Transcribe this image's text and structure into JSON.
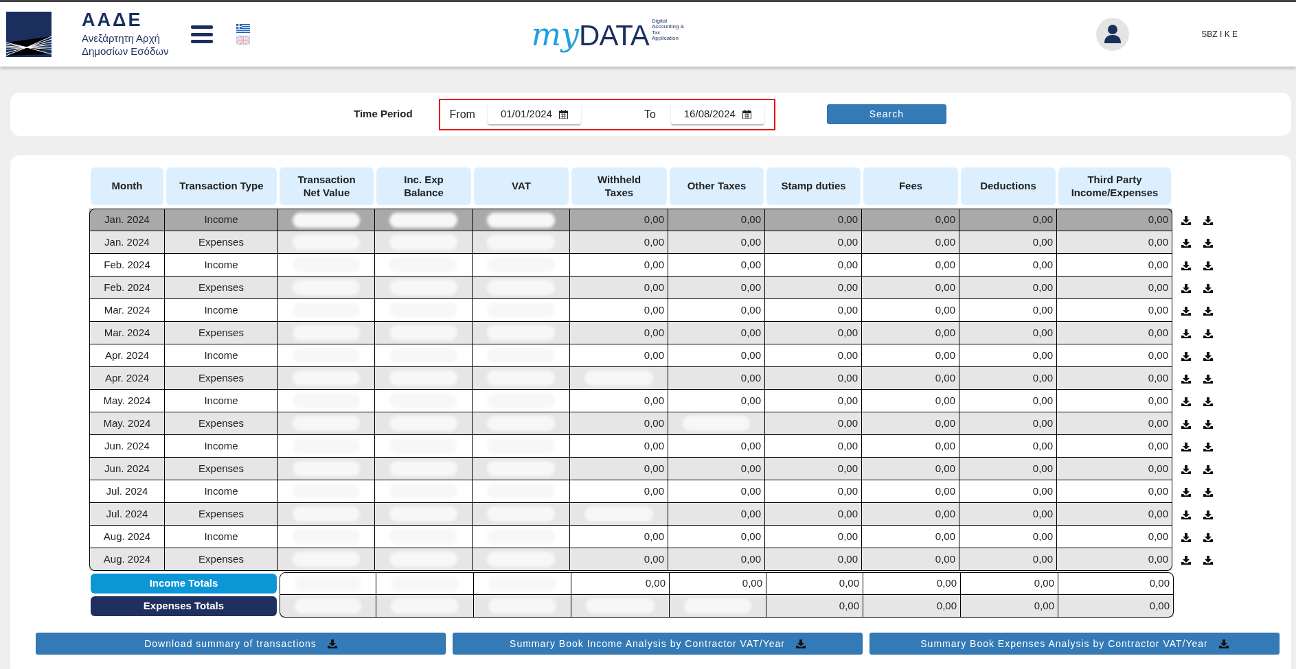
{
  "header": {
    "logo": {
      "title": "ΑΑΔΕ",
      "subtitle_lines": [
        "Ανεξάρτητη Αρχή",
        "Δημοσίων Εσόδων"
      ]
    },
    "languages": [
      {
        "kind": "greek",
        "selected": true
      },
      {
        "kind": "english",
        "selected": false
      }
    ],
    "app_logo": {
      "script": "my",
      "word": "DATA",
      "tagline_lines": [
        "Digital",
        "Accounting &",
        "Tax",
        "Application"
      ]
    },
    "user": "SBZ I K E"
  },
  "filter": {
    "label": "Time Period",
    "from_label": "From",
    "from": "01/01/2024",
    "to_label": "To",
    "to": "16/08/2024",
    "button": "Search"
  },
  "table": {
    "columns": [
      "Month",
      "Transaction Type",
      "Transaction Net Value",
      "Inc. Exp Balance",
      "VAT",
      "Withheld Taxes",
      "Other Taxes",
      "Stamp duties",
      "Fees",
      "Deductions",
      "Third Party Income/Expenses"
    ],
    "rows": [
      {
        "month": "Jan. 2024",
        "type": "Income",
        "selected": true,
        "cells": [
          {
            "kind": "redacted"
          },
          {
            "kind": "redacted"
          },
          {
            "kind": "redacted"
          },
          {
            "kind": "value",
            "text": "0,00"
          },
          {
            "kind": "value",
            "text": "0,00"
          },
          {
            "kind": "value",
            "text": "0,00"
          },
          {
            "kind": "value",
            "text": "0,00"
          },
          {
            "kind": "value",
            "text": "0,00"
          },
          {
            "kind": "value",
            "text": "0,00"
          }
        ]
      },
      {
        "month": "Jan. 2024",
        "type": "Expenses",
        "selected": false,
        "cells": [
          {
            "kind": "redacted"
          },
          {
            "kind": "redacted"
          },
          {
            "kind": "redacted"
          },
          {
            "kind": "value",
            "text": "0,00"
          },
          {
            "kind": "value",
            "text": "0,00"
          },
          {
            "kind": "value",
            "text": "0,00"
          },
          {
            "kind": "value",
            "text": "0,00"
          },
          {
            "kind": "value",
            "text": "0,00"
          },
          {
            "kind": "value",
            "text": "0,00"
          }
        ]
      },
      {
        "month": "Feb. 2024",
        "type": "Income",
        "selected": false,
        "cells": [
          {
            "kind": "redacted"
          },
          {
            "kind": "redacted"
          },
          {
            "kind": "redacted"
          },
          {
            "kind": "value",
            "text": "0,00"
          },
          {
            "kind": "value",
            "text": "0,00"
          },
          {
            "kind": "value",
            "text": "0,00"
          },
          {
            "kind": "value",
            "text": "0,00"
          },
          {
            "kind": "value",
            "text": "0,00"
          },
          {
            "kind": "value",
            "text": "0,00"
          }
        ]
      },
      {
        "month": "Feb. 2024",
        "type": "Expenses",
        "selected": false,
        "cells": [
          {
            "kind": "redacted"
          },
          {
            "kind": "redacted"
          },
          {
            "kind": "redacted"
          },
          {
            "kind": "value",
            "text": "0,00"
          },
          {
            "kind": "value",
            "text": "0,00"
          },
          {
            "kind": "value",
            "text": "0,00"
          },
          {
            "kind": "value",
            "text": "0,00"
          },
          {
            "kind": "value",
            "text": "0,00"
          },
          {
            "kind": "value",
            "text": "0,00"
          }
        ]
      },
      {
        "month": "Mar. 2024",
        "type": "Income",
        "selected": false,
        "cells": [
          {
            "kind": "redacted"
          },
          {
            "kind": "redacted"
          },
          {
            "kind": "redacted"
          },
          {
            "kind": "value",
            "text": "0,00"
          },
          {
            "kind": "value",
            "text": "0,00"
          },
          {
            "kind": "value",
            "text": "0,00"
          },
          {
            "kind": "value",
            "text": "0,00"
          },
          {
            "kind": "value",
            "text": "0,00"
          },
          {
            "kind": "value",
            "text": "0,00"
          }
        ]
      },
      {
        "month": "Mar. 2024",
        "type": "Expenses",
        "selected": false,
        "cells": [
          {
            "kind": "redacted"
          },
          {
            "kind": "redacted"
          },
          {
            "kind": "redacted"
          },
          {
            "kind": "value",
            "text": "0,00"
          },
          {
            "kind": "value",
            "text": "0,00"
          },
          {
            "kind": "value",
            "text": "0,00"
          },
          {
            "kind": "value",
            "text": "0,00"
          },
          {
            "kind": "value",
            "text": "0,00"
          },
          {
            "kind": "value",
            "text": "0,00"
          }
        ]
      },
      {
        "month": "Apr. 2024",
        "type": "Income",
        "selected": false,
        "cells": [
          {
            "kind": "redacted"
          },
          {
            "kind": "redacted"
          },
          {
            "kind": "redacted"
          },
          {
            "kind": "value",
            "text": "0,00"
          },
          {
            "kind": "value",
            "text": "0,00"
          },
          {
            "kind": "value",
            "text": "0,00"
          },
          {
            "kind": "value",
            "text": "0,00"
          },
          {
            "kind": "value",
            "text": "0,00"
          },
          {
            "kind": "value",
            "text": "0,00"
          }
        ]
      },
      {
        "month": "Apr. 2024",
        "type": "Expenses",
        "selected": false,
        "cells": [
          {
            "kind": "redacted"
          },
          {
            "kind": "redacted"
          },
          {
            "kind": "redacted"
          },
          {
            "kind": "redacted"
          },
          {
            "kind": "value",
            "text": "0,00"
          },
          {
            "kind": "value",
            "text": "0,00"
          },
          {
            "kind": "value",
            "text": "0,00"
          },
          {
            "kind": "value",
            "text": "0,00"
          },
          {
            "kind": "value",
            "text": "0,00"
          }
        ]
      },
      {
        "month": "May. 2024",
        "type": "Income",
        "selected": false,
        "cells": [
          {
            "kind": "redacted"
          },
          {
            "kind": "redacted"
          },
          {
            "kind": "redacted"
          },
          {
            "kind": "value",
            "text": "0,00"
          },
          {
            "kind": "value",
            "text": "0,00"
          },
          {
            "kind": "value",
            "text": "0,00"
          },
          {
            "kind": "value",
            "text": "0,00"
          },
          {
            "kind": "value",
            "text": "0,00"
          },
          {
            "kind": "value",
            "text": "0,00"
          }
        ]
      },
      {
        "month": "May. 2024",
        "type": "Expenses",
        "selected": false,
        "cells": [
          {
            "kind": "redacted"
          },
          {
            "kind": "redacted"
          },
          {
            "kind": "redacted"
          },
          {
            "kind": "value",
            "text": "0,00"
          },
          {
            "kind": "redacted"
          },
          {
            "kind": "value",
            "text": "0,00"
          },
          {
            "kind": "value",
            "text": "0,00"
          },
          {
            "kind": "value",
            "text": "0,00"
          },
          {
            "kind": "value",
            "text": "0,00"
          }
        ]
      },
      {
        "month": "Jun. 2024",
        "type": "Income",
        "selected": false,
        "cells": [
          {
            "kind": "redacted"
          },
          {
            "kind": "redacted"
          },
          {
            "kind": "redacted"
          },
          {
            "kind": "value",
            "text": "0,00"
          },
          {
            "kind": "value",
            "text": "0,00"
          },
          {
            "kind": "value",
            "text": "0,00"
          },
          {
            "kind": "value",
            "text": "0,00"
          },
          {
            "kind": "value",
            "text": "0,00"
          },
          {
            "kind": "value",
            "text": "0,00"
          }
        ]
      },
      {
        "month": "Jun. 2024",
        "type": "Expenses",
        "selected": false,
        "cells": [
          {
            "kind": "redacted"
          },
          {
            "kind": "redacted"
          },
          {
            "kind": "redacted"
          },
          {
            "kind": "value",
            "text": "0,00"
          },
          {
            "kind": "value",
            "text": "0,00"
          },
          {
            "kind": "value",
            "text": "0,00"
          },
          {
            "kind": "value",
            "text": "0,00"
          },
          {
            "kind": "value",
            "text": "0,00"
          },
          {
            "kind": "value",
            "text": "0,00"
          }
        ]
      },
      {
        "month": "Jul. 2024",
        "type": "Income",
        "selected": false,
        "cells": [
          {
            "kind": "redacted"
          },
          {
            "kind": "redacted"
          },
          {
            "kind": "redacted"
          },
          {
            "kind": "value",
            "text": "0,00"
          },
          {
            "kind": "value",
            "text": "0,00"
          },
          {
            "kind": "value",
            "text": "0,00"
          },
          {
            "kind": "value",
            "text": "0,00"
          },
          {
            "kind": "value",
            "text": "0,00"
          },
          {
            "kind": "value",
            "text": "0,00"
          }
        ]
      },
      {
        "month": "Jul. 2024",
        "type": "Expenses",
        "selected": false,
        "cells": [
          {
            "kind": "redacted"
          },
          {
            "kind": "redacted"
          },
          {
            "kind": "redacted"
          },
          {
            "kind": "redacted"
          },
          {
            "kind": "value",
            "text": "0,00"
          },
          {
            "kind": "value",
            "text": "0,00"
          },
          {
            "kind": "value",
            "text": "0,00"
          },
          {
            "kind": "value",
            "text": "0,00"
          },
          {
            "kind": "value",
            "text": "0,00"
          }
        ]
      },
      {
        "month": "Aug. 2024",
        "type": "Income",
        "selected": false,
        "cells": [
          {
            "kind": "redacted"
          },
          {
            "kind": "redacted"
          },
          {
            "kind": "redacted"
          },
          {
            "kind": "value",
            "text": "0,00"
          },
          {
            "kind": "value",
            "text": "0,00"
          },
          {
            "kind": "value",
            "text": "0,00"
          },
          {
            "kind": "value",
            "text": "0,00"
          },
          {
            "kind": "value",
            "text": "0,00"
          },
          {
            "kind": "value",
            "text": "0,00"
          }
        ]
      },
      {
        "month": "Aug. 2024",
        "type": "Expenses",
        "selected": false,
        "cells": [
          {
            "kind": "redacted"
          },
          {
            "kind": "redacted"
          },
          {
            "kind": "redacted"
          },
          {
            "kind": "value",
            "text": "0,00"
          },
          {
            "kind": "value",
            "text": "0,00"
          },
          {
            "kind": "value",
            "text": "0,00"
          },
          {
            "kind": "value",
            "text": "0,00"
          },
          {
            "kind": "value",
            "text": "0,00"
          },
          {
            "kind": "value",
            "text": "0,00"
          }
        ]
      }
    ],
    "totals": [
      {
        "label": "Income Totals",
        "kind": "income",
        "cells": [
          {
            "kind": "redacted"
          },
          {
            "kind": "redacted"
          },
          {
            "kind": "redacted"
          },
          {
            "kind": "value",
            "text": "0,00"
          },
          {
            "kind": "value",
            "text": "0,00"
          },
          {
            "kind": "value",
            "text": "0,00"
          },
          {
            "kind": "value",
            "text": "0,00"
          },
          {
            "kind": "value",
            "text": "0,00"
          },
          {
            "kind": "value",
            "text": "0,00"
          }
        ]
      },
      {
        "label": "Expenses Totals",
        "kind": "expenses",
        "cells": [
          {
            "kind": "redacted"
          },
          {
            "kind": "redacted"
          },
          {
            "kind": "redacted"
          },
          {
            "kind": "redacted"
          },
          {
            "kind": "redacted"
          },
          {
            "kind": "value",
            "text": "0,00"
          },
          {
            "kind": "value",
            "text": "0,00"
          },
          {
            "kind": "value",
            "text": "0,00"
          },
          {
            "kind": "value",
            "text": "0,00"
          }
        ]
      }
    ]
  },
  "buttons": [
    "Download summary of transactions",
    "Summary Book Income Analysis by Contractor VAT/Year",
    "Summary Book Expenses Analysis by Contractor VAT/Year"
  ]
}
